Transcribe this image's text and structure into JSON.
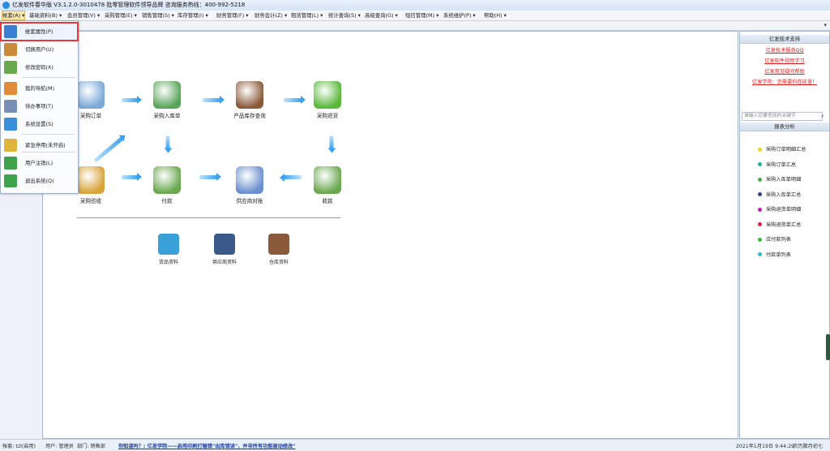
{
  "title": "亿发软件春华版 V3.1.2.0-3010478 批零管理软件领导品牌 咨询服务热线：400-992-5218",
  "menus": [
    "帐套(A)",
    "基础资料(B)",
    "会员管理(V)",
    "采购管理(E)",
    "销售管理(S)",
    "库存管理(I)",
    "财务管理(F)",
    "财务会计(Z)",
    "租赁管理(L)",
    "统计查询(S)",
    "高级查询(G)",
    "短信管理(M)",
    "系统维护(P)",
    "帮助(H)"
  ],
  "menu_arrow": "▾",
  "tab_arrow": "▾",
  "dropdown": [
    {
      "label": "帐套属性(P)",
      "icon": "account-properties-icon",
      "color": "#3b7fd4"
    },
    {
      "label": "切换用户(U)",
      "icon": "switch-user-icon",
      "color": "#c98a3a"
    },
    {
      "label": "修改密码(X)",
      "icon": "password-icon",
      "color": "#6aa84f"
    },
    {
      "label": "我的导航(M)",
      "icon": "navigation-icon",
      "color": "#e08b3a"
    },
    {
      "label": "待办事项(T)",
      "icon": "todo-icon",
      "color": "#7a8fb8"
    },
    {
      "label": "系统设置(S)",
      "icon": "settings-icon",
      "color": "#3a8fd8"
    },
    {
      "label": "紧急停用(未开启)",
      "icon": "warning-icon",
      "color": "#e0b43a"
    },
    {
      "label": "用户注销(L)",
      "icon": "logout-icon",
      "color": "#3fa34d"
    },
    {
      "label": "退出系统(Q)",
      "icon": "exit-icon",
      "color": "#3fa34d"
    }
  ],
  "flow": {
    "nodes": [
      {
        "label": "采购订单",
        "icon": "purchase-order-icon",
        "color": "#7aa8d8"
      },
      {
        "label": "采购入库单",
        "icon": "purchase-receipt-icon",
        "color": "#5aa55a"
      },
      {
        "label": "产品库存查询",
        "icon": "inventory-search-icon",
        "color": "#8a5a3a"
      },
      {
        "label": "采购退货",
        "icon": "purchase-return-icon",
        "color": "#5ab83a"
      },
      {
        "label": "采购验收",
        "icon": "purchase-inspection-icon",
        "color": "#d8a33a"
      },
      {
        "label": "付款",
        "icon": "payment-icon",
        "color": "#6aa84f"
      },
      {
        "label": "供应商对账",
        "icon": "supplier-reconcile-icon",
        "color": "#6a8fd0"
      },
      {
        "label": "收款",
        "icon": "receipt-icon",
        "color": "#6aa84f"
      }
    ],
    "resources": [
      {
        "label": "货品资料",
        "icon": "goods-icon",
        "color": "#3aa0d8"
      },
      {
        "label": "供应商资料",
        "icon": "supplier-icon",
        "color": "#3a5a8a"
      },
      {
        "label": "仓库资料",
        "icon": "warehouse-icon",
        "color": "#8a5a3a"
      }
    ]
  },
  "right_panel": {
    "support_title": "亿发技术支持",
    "support_links": [
      "亿发技术服务QQ",
      "亿发软件视频学习",
      "亿发常见疑问帮助",
      "亿发学院：您需要的在这里！"
    ],
    "search_placeholder": "请输入您要查找的关键字",
    "search_icon": "search-icon",
    "report_title": "报表分析",
    "reports": [
      {
        "label": "采购订单明细汇总",
        "color": "#f0d020"
      },
      {
        "label": "采购订单汇总",
        "color": "#20b0a0"
      },
      {
        "label": "采购入库单明细",
        "color": "#40b040"
      },
      {
        "label": "采购入库单汇总",
        "color": "#3040a0"
      },
      {
        "label": "采购退货单明细",
        "color": "#c020b0"
      },
      {
        "label": "采购退货单汇总",
        "color": "#e02040"
      },
      {
        "label": "应付款列表",
        "color": "#30c030"
      },
      {
        "label": "付款单列表",
        "color": "#20c0d0"
      }
    ]
  },
  "status": {
    "account": "帐套: tzl(启用)",
    "user": "用户: 管理员",
    "dept": "部门: 销售部",
    "scroll_text": "你知道吗？: 亿发学院——启用印刷打输错\"出库错误\"，并非所有功能被动修改\"",
    "datetime": "2021年1月19日 9:44:29",
    "lunar": "农历腊月初七"
  }
}
